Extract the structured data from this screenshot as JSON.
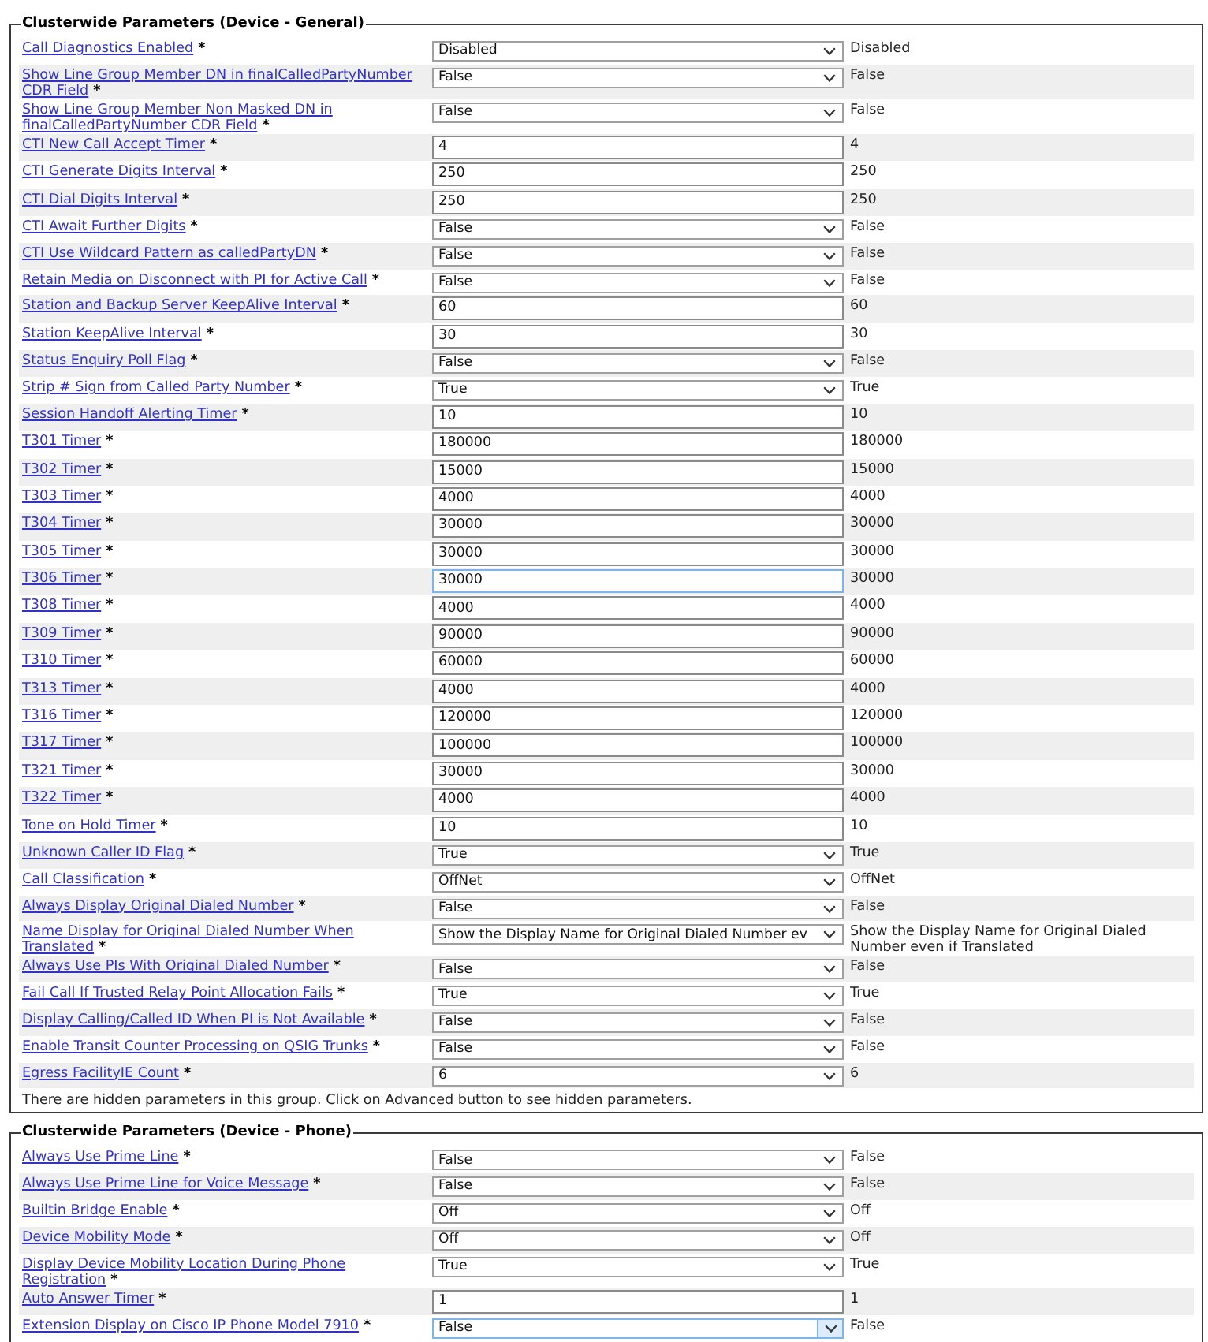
{
  "sections": [
    {
      "title": "Clusterwide Parameters (Device - General)",
      "rows": [
        {
          "label": "Call Diagnostics Enabled",
          "mark": "*",
          "kind": "select",
          "value": "Disabled",
          "focused": false,
          "default": "Disabled"
        },
        {
          "label": "Show Line Group Member DN in finalCalledPartyNumber CDR Field",
          "mark": "*",
          "kind": "select",
          "value": "False",
          "focused": false,
          "default": "False"
        },
        {
          "label": "Show Line Group Member Non Masked DN in finalCalledPartyNumber CDR Field",
          "mark": "*",
          "kind": "select",
          "value": "False",
          "focused": false,
          "default": "False"
        },
        {
          "label": "CTI New Call Accept Timer",
          "mark": "*",
          "kind": "text",
          "value": "4",
          "focused": false,
          "default": "4"
        },
        {
          "label": "CTI Generate Digits Interval",
          "mark": "*",
          "kind": "text",
          "value": "250",
          "focused": false,
          "default": "250"
        },
        {
          "label": "CTI Dial Digits Interval",
          "mark": "*",
          "kind": "text",
          "value": "250",
          "focused": false,
          "default": "250"
        },
        {
          "label": "CTI Await Further Digits",
          "mark": "*",
          "kind": "select",
          "value": "False",
          "focused": false,
          "default": "False"
        },
        {
          "label": "CTI Use Wildcard Pattern as calledPartyDN",
          "mark": "*",
          "kind": "select",
          "value": "False",
          "focused": false,
          "default": "False"
        },
        {
          "label": "Retain Media on Disconnect with PI for Active Call",
          "mark": "*",
          "kind": "select",
          "value": "False",
          "focused": false,
          "default": "False"
        },
        {
          "label": "Station and Backup Server KeepAlive Interval",
          "mark": "*",
          "kind": "text",
          "value": "60",
          "focused": false,
          "default": "60"
        },
        {
          "label": "Station KeepAlive Interval",
          "mark": "*",
          "kind": "text",
          "value": "30",
          "focused": false,
          "default": "30"
        },
        {
          "label": "Status Enquiry Poll Flag",
          "mark": "*",
          "kind": "select",
          "value": "False",
          "focused": false,
          "default": "False"
        },
        {
          "label": "Strip # Sign from Called Party Number",
          "mark": "*",
          "kind": "select",
          "value": "True",
          "focused": false,
          "default": "True"
        },
        {
          "label": "Session Handoff Alerting Timer",
          "mark": "*",
          "kind": "text",
          "value": "10",
          "focused": false,
          "default": "10"
        },
        {
          "label": "T301 Timer",
          "mark": "*",
          "kind": "text",
          "value": "180000",
          "focused": false,
          "default": "180000"
        },
        {
          "label": "T302 Timer",
          "mark": "*",
          "kind": "text",
          "value": "15000",
          "focused": false,
          "default": "15000"
        },
        {
          "label": "T303 Timer",
          "mark": "*",
          "kind": "text",
          "value": "4000",
          "focused": false,
          "default": "4000"
        },
        {
          "label": "T304 Timer",
          "mark": "*",
          "kind": "text",
          "value": "30000",
          "focused": false,
          "default": "30000"
        },
        {
          "label": "T305 Timer",
          "mark": "*",
          "kind": "text",
          "value": "30000",
          "focused": false,
          "default": "30000"
        },
        {
          "label": "T306 Timer",
          "mark": "*",
          "kind": "text",
          "value": "30000",
          "focused": true,
          "default": "30000"
        },
        {
          "label": "T308 Timer",
          "mark": "*",
          "kind": "text",
          "value": "4000",
          "focused": false,
          "default": "4000"
        },
        {
          "label": "T309 Timer",
          "mark": "*",
          "kind": "text",
          "value": "90000",
          "focused": false,
          "default": "90000"
        },
        {
          "label": "T310 Timer",
          "mark": "*",
          "kind": "text",
          "value": "60000",
          "focused": false,
          "default": "60000"
        },
        {
          "label": "T313 Timer",
          "mark": "*",
          "kind": "text",
          "value": "4000",
          "focused": false,
          "default": "4000"
        },
        {
          "label": "T316 Timer",
          "mark": "*",
          "kind": "text",
          "value": "120000",
          "focused": false,
          "default": "120000"
        },
        {
          "label": "T317 Timer",
          "mark": "*",
          "kind": "text",
          "value": "100000",
          "focused": false,
          "default": "100000"
        },
        {
          "label": "T321 Timer",
          "mark": "*",
          "kind": "text",
          "value": "30000",
          "focused": false,
          "default": "30000"
        },
        {
          "label": "T322 Timer",
          "mark": "*",
          "kind": "text",
          "value": "4000",
          "focused": false,
          "default": "4000"
        },
        {
          "label": "Tone on Hold Timer",
          "mark": "*",
          "kind": "text",
          "value": "10",
          "focused": false,
          "default": "10"
        },
        {
          "label": "Unknown Caller ID Flag",
          "mark": "*",
          "kind": "select",
          "value": "True",
          "focused": false,
          "default": "True"
        },
        {
          "label": "Call Classification",
          "mark": "*",
          "kind": "select",
          "value": "OffNet",
          "focused": false,
          "default": "OffNet"
        },
        {
          "label": "Always Display Original Dialed Number",
          "mark": "*",
          "kind": "select",
          "value": "False",
          "focused": false,
          "default": "False"
        },
        {
          "label": "Name Display for Original Dialed Number When Translated",
          "mark": "*",
          "kind": "select",
          "value": "Show the Display Name for Original Dialed Number ev",
          "focused": false,
          "default": "Show the Display Name for Original Dialed Number even if Translated"
        },
        {
          "label": "Always Use PIs With Original Dialed Number",
          "mark": "*",
          "kind": "select",
          "value": "False",
          "focused": false,
          "default": "False"
        },
        {
          "label": "Fail Call If Trusted Relay Point Allocation Fails",
          "mark": "*",
          "kind": "select",
          "value": "True",
          "focused": false,
          "default": "True"
        },
        {
          "label": "Display Calling/Called ID When PI is Not Available",
          "mark": "*",
          "kind": "select",
          "value": "False",
          "focused": false,
          "default": "False"
        },
        {
          "label": "Enable Transit Counter Processing on QSIG Trunks",
          "mark": "*",
          "kind": "select",
          "value": "False",
          "focused": false,
          "default": "False"
        },
        {
          "label": "Egress FacilityIE Count",
          "mark": "*",
          "kind": "select",
          "value": "6",
          "focused": false,
          "default": "6"
        }
      ],
      "note": "There are hidden parameters in this group. Click on Advanced button to see hidden parameters."
    },
    {
      "title": "Clusterwide Parameters (Device - Phone)",
      "rows": [
        {
          "label": "Always Use Prime Line",
          "mark": "*",
          "kind": "select",
          "value": "False",
          "focused": false,
          "default": "False"
        },
        {
          "label": "Always Use Prime Line for Voice Message",
          "mark": "*",
          "kind": "select",
          "value": "False",
          "focused": false,
          "default": "False"
        },
        {
          "label": "Builtin Bridge Enable",
          "mark": "*",
          "kind": "select",
          "value": "Off",
          "focused": false,
          "default": "Off"
        },
        {
          "label": "Device Mobility Mode",
          "mark": "*",
          "kind": "select",
          "value": "Off",
          "focused": false,
          "default": "Off"
        },
        {
          "label": "Display Device Mobility Location During Phone Registration",
          "mark": "*",
          "kind": "select",
          "value": "True",
          "focused": false,
          "default": "True"
        },
        {
          "label": "Auto Answer Timer",
          "mark": "*",
          "kind": "text",
          "value": "1",
          "focused": false,
          "default": "1"
        },
        {
          "label": "Extension Display on Cisco IP Phone Model 7910",
          "mark": "*",
          "kind": "select",
          "value": "False",
          "focused": true,
          "default": "False"
        }
      ]
    }
  ]
}
